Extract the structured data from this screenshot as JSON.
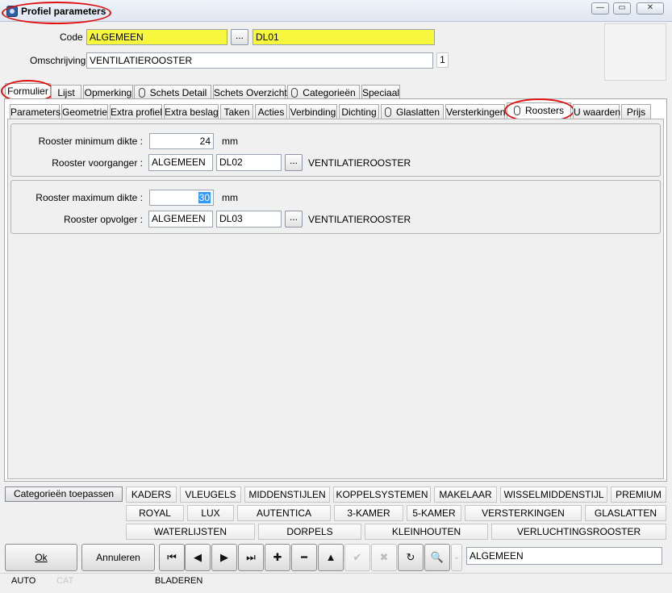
{
  "window": {
    "title": "Profiel parameters",
    "controls": {
      "minimize": "—",
      "maximize": "▭",
      "close": "✕"
    }
  },
  "header": {
    "code_label": "Code :",
    "code_value": "ALGEMEEN",
    "code_browse": "...",
    "code_sub_value": "DL01",
    "desc_label": "Omschrijving :",
    "desc_value": "VENTILATIEROOSTER",
    "desc_count": "1"
  },
  "main_tabs": [
    "Formulier",
    "Lijst",
    "Opmerking",
    "Schets Detail",
    "Schets Overzicht",
    "Categorieën",
    "Speciaal"
  ],
  "sub_tabs": [
    "Parameters",
    "Geometrie",
    "Extra profiel",
    "Extra beslag",
    "Taken",
    "Acties",
    "Verbinding",
    "Dichting",
    "Glaslatten",
    "Versterkingen",
    "Roosters",
    "U waarden",
    "Prijs"
  ],
  "roosters": {
    "min_label": "Rooster minimum dikte :",
    "min_value": "24",
    "min_unit": "mm",
    "prev_label": "Rooster voorganger :",
    "prev_code": "ALGEMEEN",
    "prev_sub": "DL02",
    "prev_browse": "...",
    "prev_desc": "VENTILATIEROOSTER",
    "max_label": "Rooster maximum dikte :",
    "max_value": "30",
    "max_unit": "mm",
    "next_label": "Rooster opvolger :",
    "next_code": "ALGEMEEN",
    "next_sub": "DL03",
    "next_browse": "...",
    "next_desc": "VENTILATIEROOSTER"
  },
  "categories": {
    "apply_label": "Categorieën toepassen",
    "row1": [
      "KADERS",
      "VLEUGELS",
      "MIDDENSTIJLEN",
      "KOPPELSYSTEMEN",
      "MAKELAAR",
      "WISSELMIDDENSTIJL",
      "PREMIUM"
    ],
    "row2": [
      "ROYAL",
      "LUX",
      "AUTENTICA",
      "3-KAMER",
      "5-KAMER",
      "VERSTERKINGEN",
      "GLASLATTEN"
    ],
    "row3": [
      "WATERLIJSTEN",
      "DORPELS",
      "KLEINHOUTEN",
      "VERLUCHTINGSROOSTER"
    ]
  },
  "actions": {
    "ok_label": "Ok",
    "cancel_label": "Annuleren",
    "nav_icons": [
      "⏮",
      "◀",
      "▶",
      "⏭",
      "✚",
      "━",
      "▲",
      "✔",
      "✖",
      "↻",
      "🔍",
      "⌄"
    ],
    "search_value": "ALGEMEEN"
  },
  "status": {
    "mode1": "AUTO",
    "mode2": "CAT",
    "mode3": "BLADEREN"
  },
  "colors": {
    "highlight_yellow": "#f7f73d",
    "selection_blue": "#3399ff",
    "annotation_red": "#e01010"
  }
}
